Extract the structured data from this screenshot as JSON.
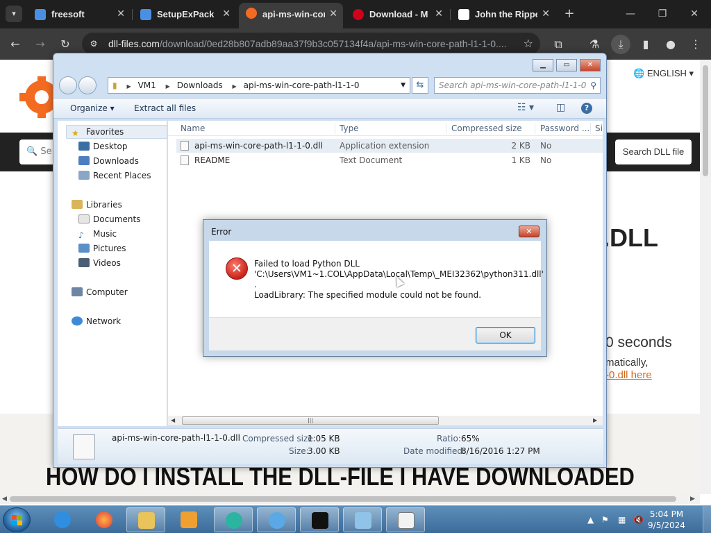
{
  "browser": {
    "tabs": [
      {
        "label": "freesoft",
        "favicon": "#4a90e2"
      },
      {
        "label": "SetupExPack",
        "favicon": "#4a90e2"
      },
      {
        "label": "api-ms-win-core",
        "favicon": "#f26b21"
      },
      {
        "label": "Download - M",
        "favicon": "#d0021b"
      },
      {
        "label": "John the Ripper",
        "favicon": "#ffffff"
      }
    ],
    "url_host": "dll-files.com",
    "url_path": "/download/0ed28b807adb89aa37f9b3c057134f4a/api-ms-win-core-path-l1-1-0...."
  },
  "site": {
    "language": "ENGLISH",
    "search_placeholder": "Se",
    "search_button": "Search DLL file",
    "heading_fragment": ".DLL",
    "seconds_text": "0 seconds",
    "matically_text": "matically,",
    "link_text": "-0.dll here",
    "howto_heading": "HOW DO I INSTALL THE DLL-FILE I HAVE DOWNLOADED"
  },
  "explorer": {
    "address": [
      "VM1",
      "Downloads",
      "api-ms-win-core-path-l1-1-0"
    ],
    "search_placeholder": "Search api-ms-win-core-path-l1-1-0",
    "organize": "Organize",
    "extract_all": "Extract all files",
    "nav": {
      "favorites": "Favorites",
      "desktop": "Desktop",
      "downloads": "Downloads",
      "recent": "Recent Places",
      "libraries": "Libraries",
      "documents": "Documents",
      "music": "Music",
      "pictures": "Pictures",
      "videos": "Videos",
      "computer": "Computer",
      "network": "Network"
    },
    "columns": {
      "name": "Name",
      "type": "Type",
      "compressed": "Compressed size",
      "password": "Password ...",
      "size": "Si"
    },
    "files": [
      {
        "name": "api-ms-win-core-path-l1-1-0.dll",
        "type": "Application extension",
        "compressed": "2 KB",
        "password": "No"
      },
      {
        "name": "README",
        "type": "Text Document",
        "compressed": "1 KB",
        "password": "No"
      }
    ],
    "details": {
      "filename": "api-ms-win-core-path-l1-1-0.dll",
      "compressed_label": "Compressed size:",
      "compressed_value": "1.05 KB",
      "size_label": "Size:",
      "size_value": "3.00 KB",
      "ratio_label": "Ratio:",
      "ratio_value": "65%",
      "modified_label": "Date modified:",
      "modified_value": "8/16/2016 1:27 PM"
    }
  },
  "dialog": {
    "title": "Error",
    "line1": "Failed to load Python DLL",
    "line2": "'C:\\Users\\VM1~1.COL\\AppData\\Local\\Temp\\_MEI32362\\python311.dll'",
    "line3": ".",
    "line4": "LoadLibrary: The specified module could not be found.",
    "ok": "OK"
  },
  "taskbar": {
    "time": "5:04 PM",
    "date": "9/5/2024"
  }
}
